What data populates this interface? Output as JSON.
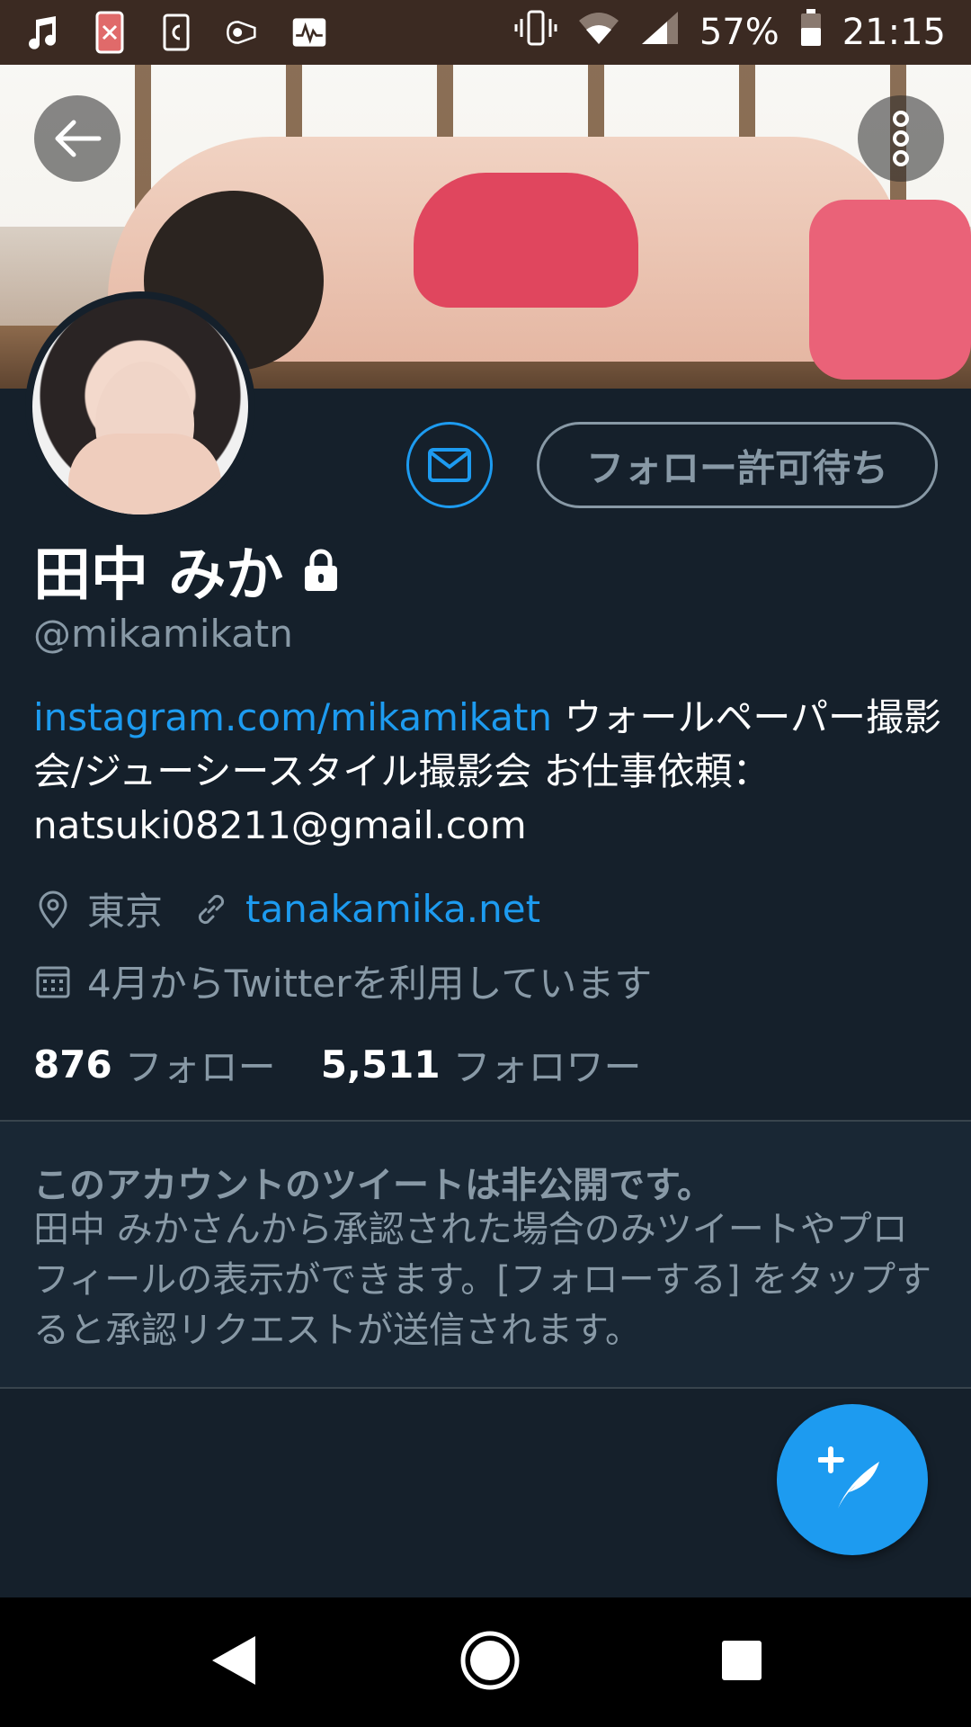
{
  "status_bar": {
    "battery": "57%",
    "time": "21:15"
  },
  "profile": {
    "name": "田中 みか",
    "handle": "@mikamikatn",
    "dm_icon": "mail-icon",
    "follow_button": "フォロー許可待ち",
    "bio_link": "instagram.com/mikamikatn",
    "bio_text": " ウォールペーパー撮影会/ジューシースタイル撮影会 お仕事依頼：natsuki08211@gmail.com",
    "location": "東京",
    "website": "tanakamika.net",
    "joined": "4月からTwitterを利用しています",
    "following_count": "876",
    "following_label": "フォロー",
    "followers_count": "5,511",
    "followers_label": "フォロワー"
  },
  "private_notice": {
    "title": "このアカウントのツイートは非公開です。",
    "body": "田中 みかさんから承認された場合のみツイートやプロフィールの表示ができます。[フォローする] をタップすると承認リクエストが送信されます。"
  },
  "colors": {
    "background": "#15202b",
    "accent": "#1d9bf0",
    "muted": "#8899a6"
  }
}
